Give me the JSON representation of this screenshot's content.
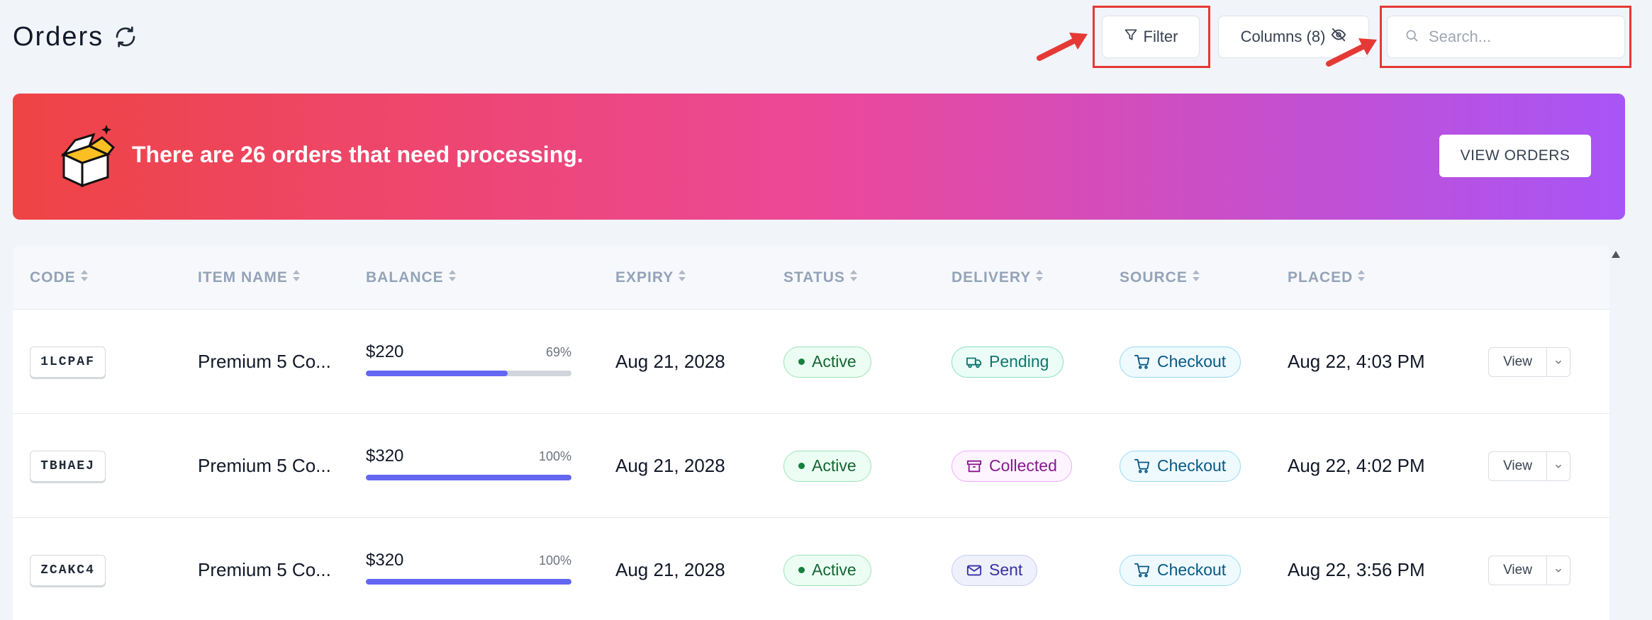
{
  "header": {
    "title": "Orders",
    "filter_label": "Filter",
    "columns_label": "Columns (8)",
    "search_placeholder": "Search..."
  },
  "banner": {
    "message": "There are 26 orders that need processing.",
    "button_label": "VIEW ORDERS"
  },
  "table": {
    "columns": [
      "CODE",
      "ITEM NAME",
      "BALANCE",
      "EXPIRY",
      "STATUS",
      "DELIVERY",
      "SOURCE",
      "PLACED"
    ],
    "rows": [
      {
        "code": "1LCPAF",
        "item": "Premium 5 Co...",
        "balance": "$220",
        "percent_label": "69%",
        "percent": 69,
        "expiry": "Aug 21, 2028",
        "status": "Active",
        "delivery": "Pending",
        "delivery_kind": "pending",
        "source": "Checkout",
        "placed": "Aug 22, 4:03 PM",
        "view_label": "View"
      },
      {
        "code": "TBHAEJ",
        "item": "Premium 5 Co...",
        "balance": "$320",
        "percent_label": "100%",
        "percent": 100,
        "expiry": "Aug 21, 2028",
        "status": "Active",
        "delivery": "Collected",
        "delivery_kind": "collected",
        "source": "Checkout",
        "placed": "Aug 22, 4:02 PM",
        "view_label": "View"
      },
      {
        "code": "ZCAKC4",
        "item": "Premium 5 Co...",
        "balance": "$320",
        "percent_label": "100%",
        "percent": 100,
        "expiry": "Aug 21, 2028",
        "status": "Active",
        "delivery": "Sent",
        "delivery_kind": "sent",
        "source": "Checkout",
        "placed": "Aug 22, 3:56 PM",
        "view_label": "View"
      }
    ]
  },
  "icons": {
    "refresh": "refresh-icon",
    "filter": "filter-icon",
    "columns": "eye-off-icon",
    "search": "search-icon",
    "banner": "box-icon",
    "pending": "truck-icon",
    "collected": "archive-icon",
    "sent": "mail-icon",
    "checkout": "cart-icon"
  },
  "colors": {
    "accent": "#6366f1",
    "banner_start": "#ef4444",
    "banner_mid": "#ec4899",
    "banner_end": "#a855f7",
    "annotation": "#e53935"
  }
}
